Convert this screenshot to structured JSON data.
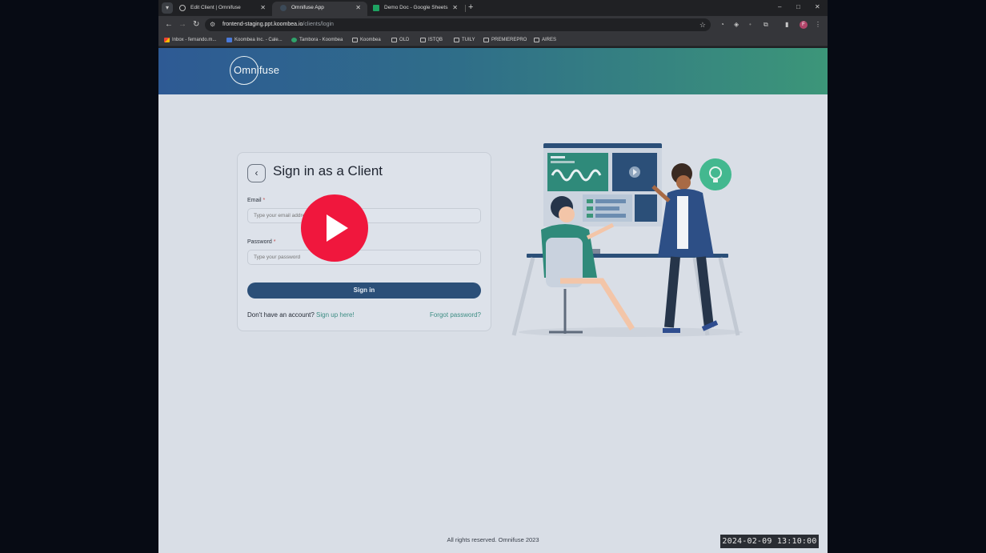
{
  "browser": {
    "tabs": [
      {
        "title": "Edit Client | Omnifuse",
        "active": false
      },
      {
        "title": "Omnifuse App",
        "active": true
      },
      {
        "title": "Demo Doc - Google Sheets",
        "active": false
      }
    ],
    "tab_search_icon": "chevron-down-icon",
    "new_tab_label": "+",
    "window_controls": {
      "minimize": "–",
      "maximize": "□",
      "close": "✕"
    },
    "address": {
      "host": "frontend-staging.ppt.koombea.io",
      "path": "/clients/login"
    },
    "bookmarks": [
      "Inbox - fernando.m...",
      "Koombea Inc. - Cale...",
      "Tambora - Koombea",
      "Koombea",
      "OLD",
      "ISTQB",
      "TUILY",
      "PREMIEREPRO",
      "AIRES"
    ],
    "profile_initial": "F"
  },
  "app": {
    "brand": "Omnifuse",
    "header_gradient": [
      "#2e5a94",
      "#3c9679"
    ]
  },
  "login": {
    "title": "Sign in as a Client",
    "email_label": "Email",
    "email_placeholder": "Type your email address",
    "password_label": "Password",
    "password_placeholder": "Type your password",
    "required_mark": "*",
    "submit_label": "Sign in",
    "signup_prompt": "Don't have an account?",
    "signup_link": "Sign up here!",
    "forgot_link": "Forgot password?"
  },
  "footer": {
    "text": "All rights reserved. Omnifuse 2023"
  },
  "overlay": {
    "timestamp": "2024-02-09 13:10:00",
    "play_color": "#f0173d"
  }
}
